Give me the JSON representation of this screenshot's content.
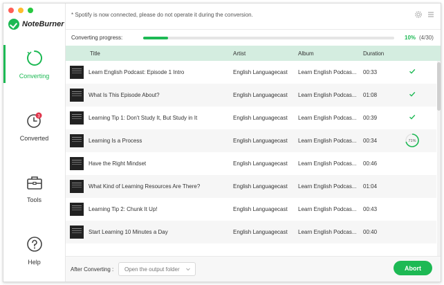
{
  "app": {
    "name": "NoteBurner"
  },
  "traffic_lights": {
    "close": "#ff5f57",
    "minimize": "#febc2e",
    "zoom": "#28c840"
  },
  "colors": {
    "accent": "#1db954",
    "header_bg": "#d4ede0"
  },
  "sidebar": {
    "items": [
      {
        "label": "Converting",
        "icon": "converting-icon",
        "active": true
      },
      {
        "label": "Converted",
        "icon": "clock-icon",
        "badge": "3"
      },
      {
        "label": "Tools",
        "icon": "toolbox-icon"
      },
      {
        "label": "Help",
        "icon": "help-icon"
      }
    ]
  },
  "topbar": {
    "notice": "* Spotify is now connected, please do not operate it during the conversion."
  },
  "progress": {
    "label": "Converting progress:",
    "percent_text": "10%",
    "count_text": "(4/30)",
    "fraction": 0.1
  },
  "table": {
    "columns": [
      "Title",
      "Artist",
      "Album",
      "Duration"
    ],
    "rows": [
      {
        "title": "Learn English Podcast: Episode 1 Intro",
        "artist": "English Languagecast",
        "album": "Learn English Podcas...",
        "duration": "00:33",
        "status": "done"
      },
      {
        "title": "What Is This Episode About?",
        "artist": "English Languagecast",
        "album": "Learn English Podcas...",
        "duration": "01:08",
        "status": "done"
      },
      {
        "title": "Learning Tip 1: Don't Study It, But Study in It",
        "artist": "English Languagecast",
        "album": "Learn English Podcas...",
        "duration": "00:39",
        "status": "done"
      },
      {
        "title": "Learning Is a Process",
        "artist": "English Languagecast",
        "album": "Learn English Podcas...",
        "duration": "00:34",
        "status": "progress",
        "progress_text": "71%",
        "progress_value": 0.71
      },
      {
        "title": "Have the Right Mindset",
        "artist": "English Languagecast",
        "album": "Learn English Podcas...",
        "duration": "00:46",
        "status": "pending"
      },
      {
        "title": "What Kind of Learning Resources Are There?",
        "artist": "English Languagecast",
        "album": "Learn English Podcas...",
        "duration": "01:04",
        "status": "pending"
      },
      {
        "title": "Learning Tip 2: Chunk It Up!",
        "artist": "English Languagecast",
        "album": "Learn English Podcas...",
        "duration": "00:43",
        "status": "pending"
      },
      {
        "title": "Start Learning 10 Minutes a Day",
        "artist": "English Languagecast",
        "album": "Learn English Podcas...",
        "duration": "00:40",
        "status": "pending"
      }
    ]
  },
  "footer": {
    "after_label": "After Converting :",
    "after_value": "Open the output folder",
    "abort_label": "Abort"
  }
}
